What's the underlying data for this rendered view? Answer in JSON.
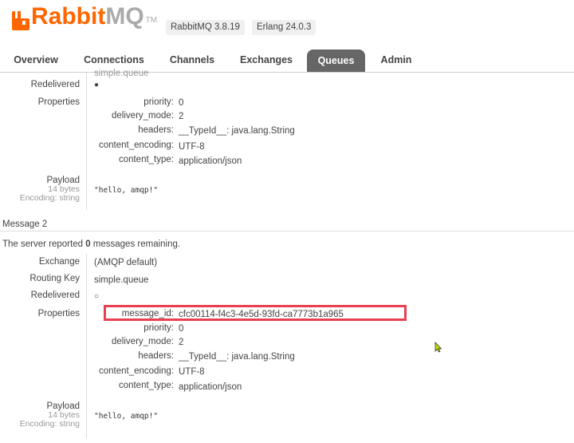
{
  "header": {
    "logo_rabbit": "Rabbit",
    "logo_mq": "MQ",
    "logo_tm": "TM",
    "rabbit_version": "RabbitMQ 3.8.19",
    "erlang_version": "Erlang 24.0.3"
  },
  "tabs": [
    {
      "label": "Overview"
    },
    {
      "label": "Connections"
    },
    {
      "label": "Channels"
    },
    {
      "label": "Exchanges"
    },
    {
      "label": "Queues",
      "active": true
    },
    {
      "label": "Admin"
    }
  ],
  "message1": {
    "cut_value": "simple.queue",
    "redelivered_label": "Redelivered",
    "redelivered_value": "●",
    "properties_label": "Properties",
    "props": [
      {
        "key": "priority:",
        "value": "0"
      },
      {
        "key": "delivery_mode:",
        "value": "2"
      },
      {
        "key": "headers:",
        "value": "__TypeId__: java.lang.String"
      },
      {
        "key": "content_encoding:",
        "value": "UTF-8"
      },
      {
        "key": "content_type:",
        "value": "application/json"
      }
    ],
    "payload_label": "Payload",
    "payload_size": "14 bytes",
    "payload_encoding": "Encoding: string",
    "payload_value": "\"hello, amqp!\""
  },
  "message2": {
    "title": "Message 2",
    "server_report_prefix": "The server reported ",
    "server_report_count": "0",
    "server_report_suffix": " messages remaining.",
    "exchange_label": "Exchange",
    "exchange_value": "(AMQP default)",
    "routing_key_label": "Routing Key",
    "routing_key_value": "simple.queue",
    "redelivered_label": "Redelivered",
    "redelivered_value": "○",
    "properties_label": "Properties",
    "props": [
      {
        "key": "message_id:",
        "value": "cfc00114-f4c3-4e5d-93fd-ca7773b1a965"
      },
      {
        "key": "priority:",
        "value": "0"
      },
      {
        "key": "delivery_mode:",
        "value": "2"
      },
      {
        "key": "headers:",
        "value": "__TypeId__: java.lang.String"
      },
      {
        "key": "content_encoding:",
        "value": "UTF-8"
      },
      {
        "key": "content_type:",
        "value": "application/json"
      }
    ],
    "payload_label": "Payload",
    "payload_size": "14 bytes",
    "payload_encoding": "Encoding: string",
    "payload_value": "\"hello, amqp!\""
  },
  "colors": {
    "brand": "#ff6600",
    "highlight": "#e84050",
    "active_tab": "#666666"
  }
}
